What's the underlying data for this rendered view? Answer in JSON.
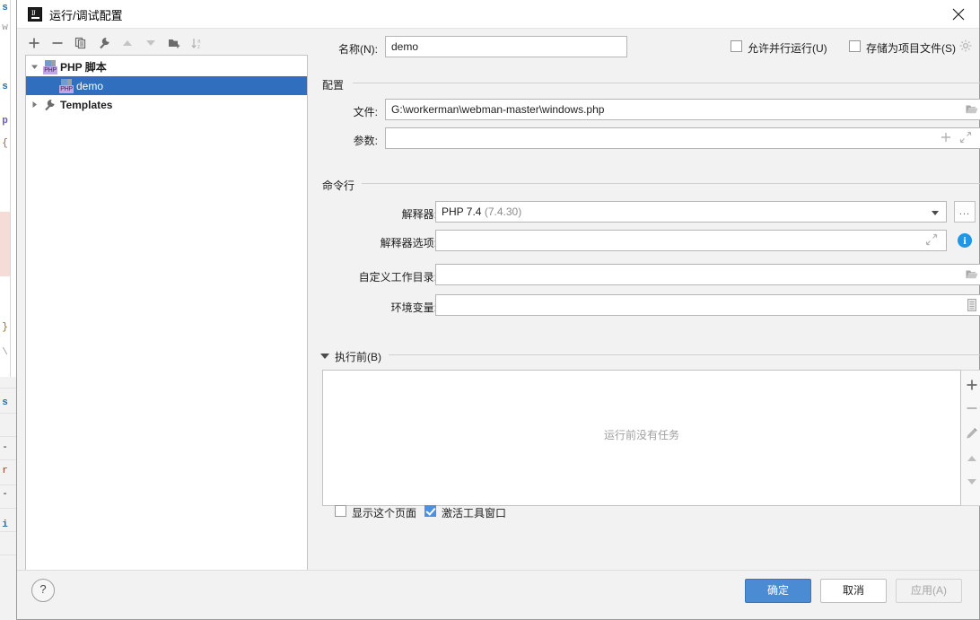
{
  "window": {
    "title": "运行/调试配置",
    "app_icon": "intellij-idea-icon",
    "close_icon": "close-icon"
  },
  "tree_toolbar": {
    "buttons": [
      {
        "name": "add-configuration-button",
        "icon": "plus-icon"
      },
      {
        "name": "remove-configuration-button",
        "icon": "minus-icon"
      },
      {
        "name": "copy-configuration-button",
        "icon": "copy-icon"
      },
      {
        "name": "edit-templates-button",
        "icon": "wrench-icon"
      },
      {
        "name": "move-up-button",
        "icon": "arrow-up-icon"
      },
      {
        "name": "move-down-button",
        "icon": "arrow-down-icon"
      },
      {
        "name": "new-folder-button",
        "icon": "folder-add-icon"
      },
      {
        "name": "sort-configurations-button",
        "icon": "sort-alpha-icon"
      }
    ]
  },
  "tree": {
    "nodes": [
      {
        "label": "PHP 脚本",
        "level": 0,
        "expanded": true,
        "icon": "php-script-icon",
        "selected": false,
        "bold": true
      },
      {
        "label": "demo",
        "level": 1,
        "expanded": null,
        "icon": "php-script-icon",
        "selected": true,
        "bold": false
      },
      {
        "label": "Templates",
        "level": 0,
        "expanded": false,
        "icon": "wrench-icon",
        "selected": false,
        "bold": true
      }
    ]
  },
  "form": {
    "name_label": "名称(N):",
    "name_value": "demo",
    "allow_parallel_label": "允许并行运行(U)",
    "allow_parallel_checked": false,
    "store_as_project_file_label": "存储为项目文件(S)",
    "store_as_project_file_checked": false,
    "store_gear_icon": "gear-icon",
    "configuration_section": "配置",
    "file_label": "文件:",
    "file_value": "G:\\workerman\\webman-master\\windows.php",
    "file_browse_icon": "folder-open-icon",
    "arguments_label": "参数:",
    "arguments_value": "",
    "arguments_add_icon": "plus-icon",
    "arguments_expand_icon": "expand-icon",
    "commandline_section": "命令行",
    "interpreter_label": "解释器:",
    "interpreter_value": "PHP 7.4",
    "interpreter_version": "(7.4.30)",
    "interpreter_more_label": "...",
    "interpreter_dropdown_icon": "chevron-down-icon",
    "interpreter_options_label": "解释器选项:",
    "interpreter_options_value": "",
    "interpreter_options_expand_icon": "expand-icon",
    "interpreter_options_info_icon": "info-icon",
    "custom_working_dir_label": "自定义工作目录:",
    "custom_working_dir_value": "",
    "custom_working_dir_browse_icon": "folder-open-icon",
    "env_vars_label": "环境变量:",
    "env_vars_value": "",
    "env_vars_icon": "list-edit-icon",
    "before_launch_label": "执行前(B)",
    "before_launch_expanded": true,
    "before_launch_empty_text": "运行前没有任务",
    "task_toolbar": [
      {
        "name": "add-task-button",
        "icon": "plus-icon"
      },
      {
        "name": "remove-task-button",
        "icon": "minus-icon"
      },
      {
        "name": "edit-task-button",
        "icon": "pencil-icon"
      },
      {
        "name": "move-task-up-button",
        "icon": "arrow-up-icon"
      },
      {
        "name": "move-task-down-button",
        "icon": "arrow-down-icon"
      }
    ],
    "show_page_label": "显示这个页面",
    "show_page_checked": false,
    "activate_tool_window_label": "激活工具窗口",
    "activate_tool_window_checked": true
  },
  "footer": {
    "help_label": "?",
    "ok_label": "确定",
    "cancel_label": "取消",
    "apply_label": "应用(A)",
    "apply_enabled": false
  },
  "colors": {
    "selection_blue": "#2f6fbd",
    "primary_button": "#4a8bd4",
    "checkbox_checked": "#4d90e0",
    "info_blue": "#2196e3",
    "dialog_bg": "#f2f2f2"
  }
}
